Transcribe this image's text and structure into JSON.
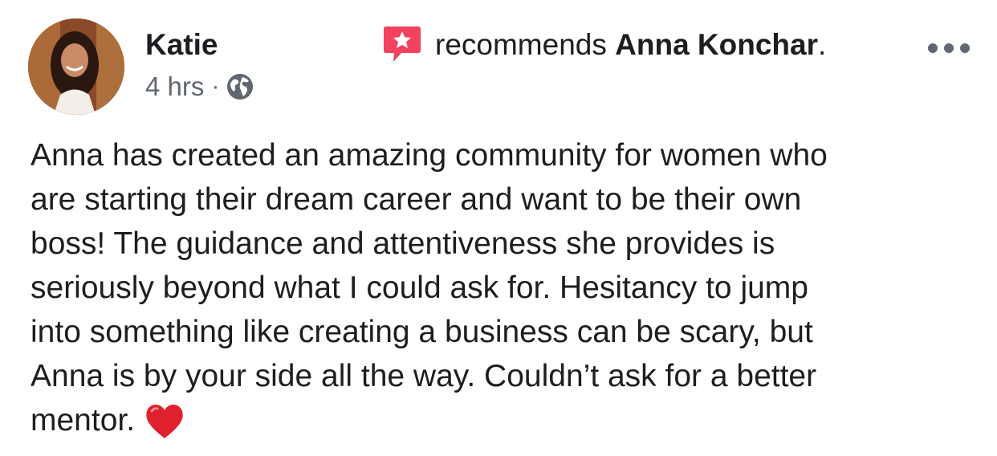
{
  "post": {
    "author": "Katie",
    "timestamp": "4 hrs",
    "separator": "·",
    "privacy_icon": "globe-icon",
    "recommend_icon": "recommendation-star-icon",
    "recommend_verb": "recommends",
    "page_name": "Anna Konchar",
    "recommend_end": ".",
    "more_icon": "more-options-icon",
    "body_lines": [
      "Anna has created an amazing community for women who",
      "are starting their dream career and want to be their own",
      "boss! The guidance and attentiveness she provides is",
      "seriously beyond what I could ask for. Hesitancy to jump",
      "into something like creating a business can be scary, but",
      "Anna is by your side all the way. Couldn’t ask for a better",
      "mentor."
    ],
    "emoji": "red-heart-icon"
  },
  "colors": {
    "text": "#1c1e21",
    "secondary_text": "#606770",
    "recommend_accent": "#f3425f",
    "heart": "#e0202c"
  }
}
